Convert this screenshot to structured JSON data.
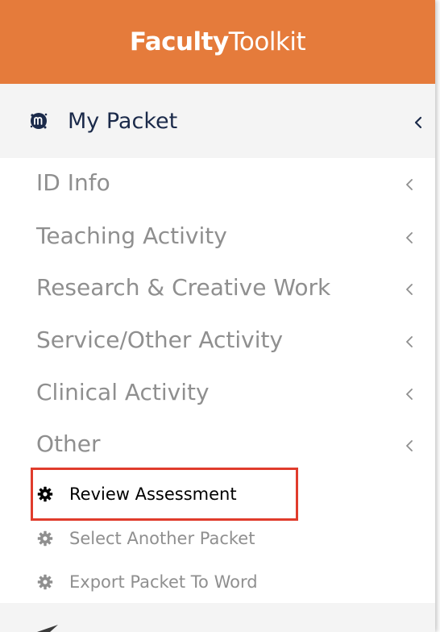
{
  "header": {
    "brand_part1": "Faculty",
    "brand_part2": "Toolkit"
  },
  "packet": {
    "title": "My Packet",
    "icon": "m-logo-icon",
    "chevron": "chevron-left-icon"
  },
  "menu": {
    "items": [
      {
        "label": "ID Info",
        "icon": "chevron-left-icon"
      },
      {
        "label": "Teaching Activity",
        "icon": "chevron-left-icon"
      },
      {
        "label": "Research & Creative Work",
        "icon": "chevron-left-icon"
      },
      {
        "label": "Service/Other Activity",
        "icon": "chevron-left-icon"
      },
      {
        "label": "Clinical Activity",
        "icon": "chevron-left-icon"
      },
      {
        "label": "Other",
        "icon": "chevron-left-icon"
      }
    ],
    "sub_items": [
      {
        "label": "Review Assessment",
        "icon": "gear-icon"
      },
      {
        "label": "Select Another Packet",
        "icon": "gear-icon"
      },
      {
        "label": "Export Packet To Word",
        "icon": "gear-icon"
      }
    ]
  },
  "colors": {
    "header_bg": "#e57b3b",
    "highlight_border": "#e03c2c",
    "menu_text": "#8f8f8f",
    "title_text": "#1b2a4a"
  }
}
